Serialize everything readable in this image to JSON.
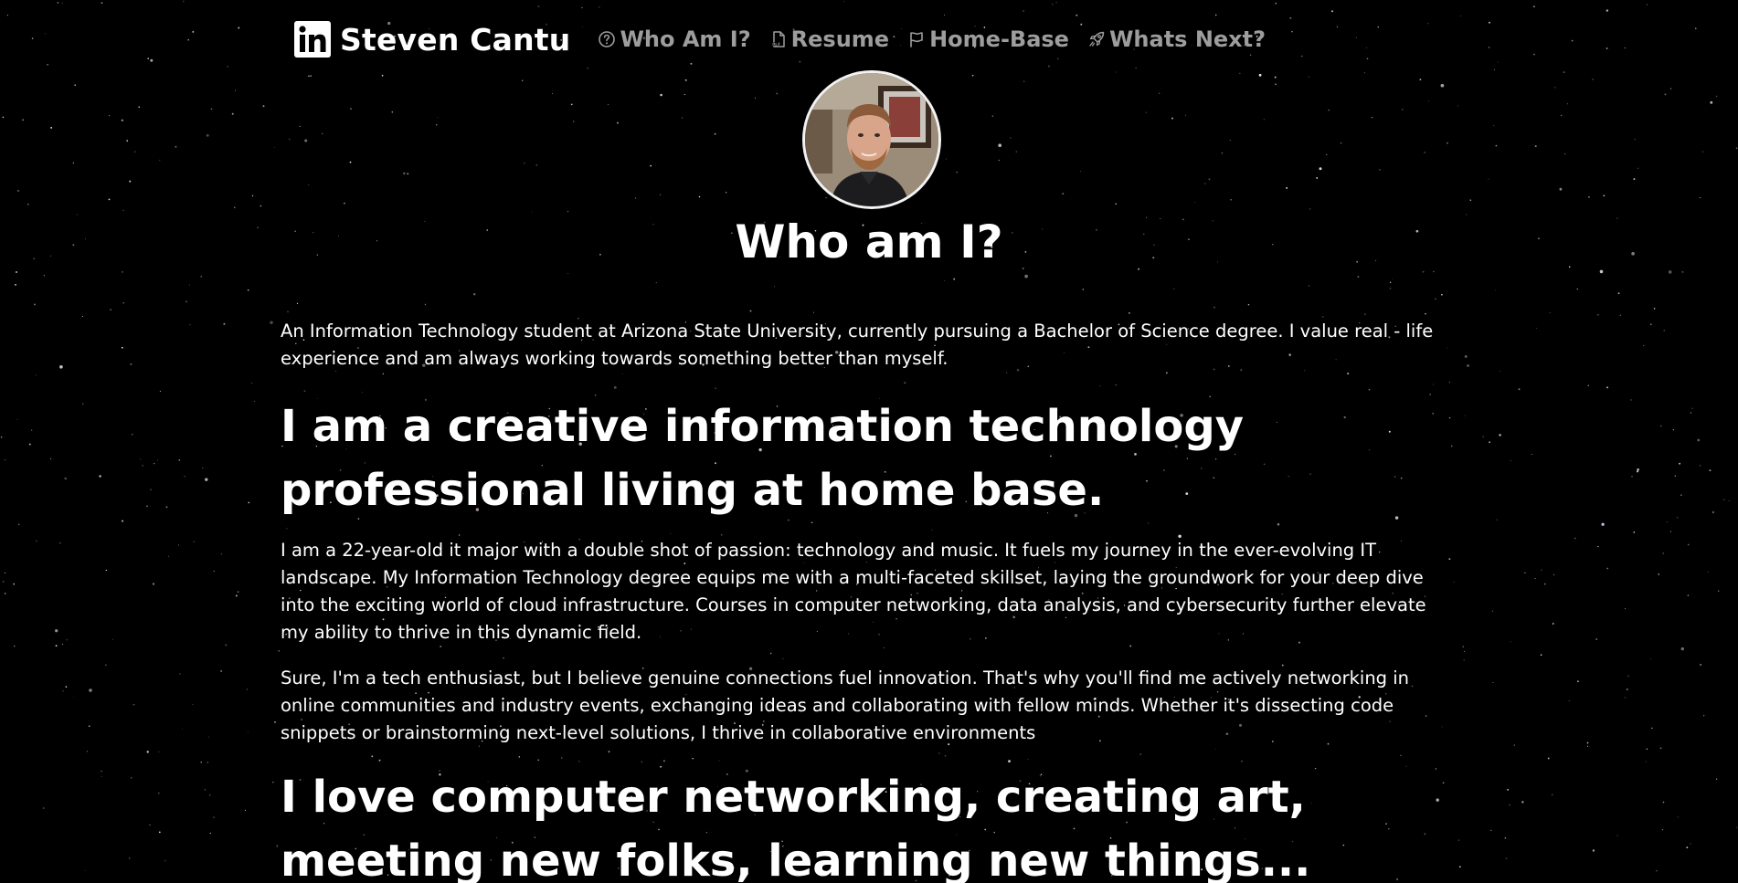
{
  "nav": {
    "brand_name": "Steven Cantu",
    "brand_icon": "linkedin-icon",
    "links": [
      {
        "label": "Who Am I?",
        "icon": "question-circle-icon"
      },
      {
        "label": "Resume",
        "icon": "pdf-file-icon"
      },
      {
        "label": "Home-Base",
        "icon": "flag-icon"
      },
      {
        "label": "Whats Next?",
        "icon": "rocket-icon"
      }
    ]
  },
  "hero": {
    "avatar": "profile-photo",
    "title": "Who am I?"
  },
  "content": {
    "intro": "An Information Technology student at Arizona State University, currently pursuing a Bachelor of Science degree. I value real - life experience and am always working towards something better than myself.",
    "heading_1": "I am a creative information technology professional living at home base.",
    "paragraph_1": "I am a 22-year-old it major with a double shot of passion: technology and music. It fuels my journey in the ever-evolving IT landscape. My Information Technology degree equips me with a multi-faceted skillset, laying the groundwork for your deep dive into the exciting world of cloud infrastructure. Courses in computer networking, data analysis, and cybersecurity further elevate my ability to thrive in this dynamic field.",
    "paragraph_2": "Sure, I'm a tech enthusiast, but I believe genuine connections fuel innovation. That's why you'll find me actively networking in online communities and industry events, exchanging ideas and collaborating with fellow minds. Whether it's dissecting code snippets or brainstorming next-level solutions, I thrive in collaborative environments",
    "heading_2": "I love computer networking, creating art, meeting new folks, learning new things..."
  },
  "colors": {
    "background": "#000000",
    "text": "#ffffff",
    "nav_link": "#9d9d9d",
    "star": "#ffffff"
  }
}
